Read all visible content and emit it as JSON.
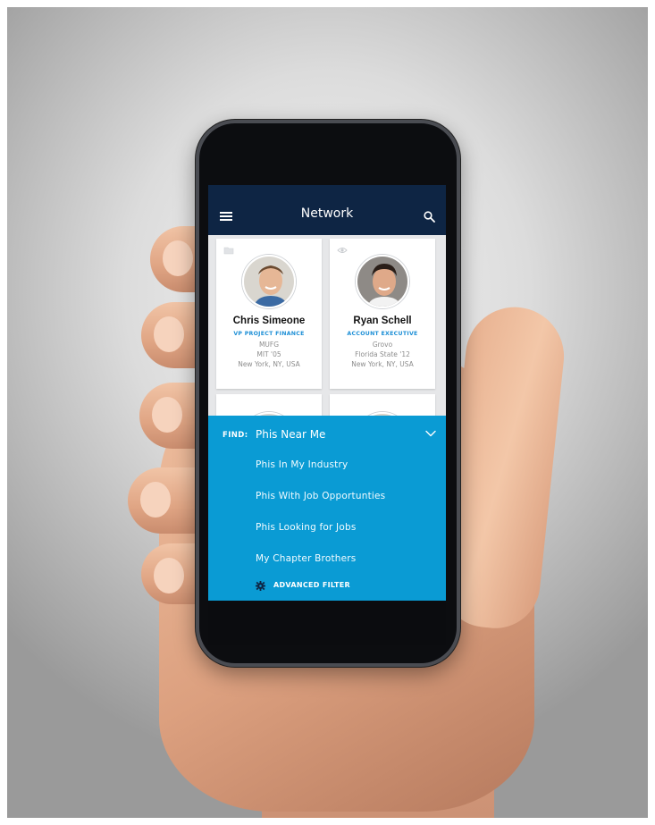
{
  "header": {
    "title": "Network",
    "menu_icon": "hamburger-icon",
    "search_icon": "search-icon",
    "background": "#0e2544"
  },
  "cards": [
    {
      "name": "Chris Simeone",
      "role": "VP PROJECT FINANCE",
      "company": "MUFG",
      "school": "MIT '05",
      "location": "New York, NY, USA",
      "corner_icon": "folder-icon"
    },
    {
      "name": "Ryan Schell",
      "role": "ACCOUNT EXECUTIVE",
      "company": "Grovo",
      "school": "Florida State '12",
      "location": "New York, NY, USA",
      "corner_icon": "eye-icon"
    }
  ],
  "find_sheet": {
    "label": "FIND:",
    "selected": "Phis Near Me",
    "options": [
      "Phis In My Industry",
      "Phis With Job Opportunties",
      "Phis Looking for Jobs",
      "My Chapter Brothers"
    ],
    "advanced_filter": "ADVANCED FILTER",
    "advanced_icon": "gear-icon",
    "chevron_icon": "chevron-down-icon",
    "background": "#0a9bd4"
  },
  "colors": {
    "accent": "#1d8fd6"
  }
}
